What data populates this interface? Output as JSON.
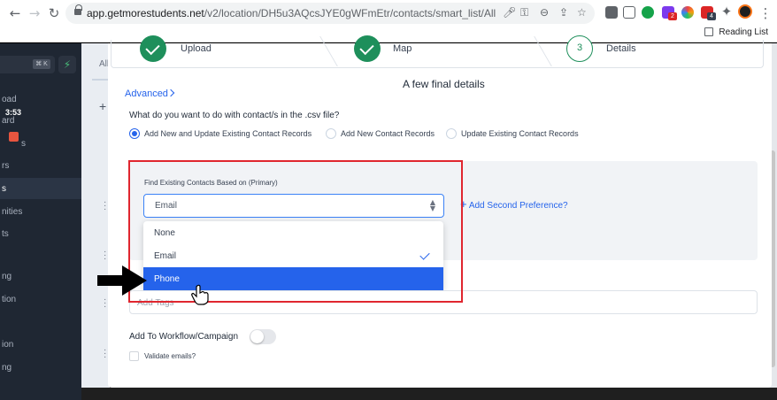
{
  "browser": {
    "url_host": "app.getmorestudents.net",
    "url_path": "/v2/location/DH5u3AQcsJYE0gWFmEtr/contacts/smart_list/All",
    "reading_list_label": "Reading List",
    "extension_badges": [
      "2",
      "4"
    ]
  },
  "sidebar": {
    "search_kbd": "⌘ K",
    "time": "3:53",
    "items": [
      {
        "label": "oad"
      },
      {
        "label": "ard"
      },
      {
        "label": "s"
      },
      {
        "label": "rs"
      },
      {
        "label": "s"
      },
      {
        "label": "nities"
      },
      {
        "label": "ts"
      },
      {
        "label": "ng"
      },
      {
        "label": "tion"
      },
      {
        "label": "ion"
      },
      {
        "label": "ng"
      }
    ]
  },
  "background": {
    "tab_label": "All",
    "add_label": "+"
  },
  "stepper": {
    "steps": [
      {
        "number": "",
        "label": "Upload",
        "status": "done"
      },
      {
        "number": "",
        "label": "Map",
        "status": "done"
      },
      {
        "number": "3",
        "label": "Details",
        "status": "current"
      }
    ]
  },
  "modal": {
    "advanced_label": "Advanced",
    "heading": "A few final details",
    "question": "What do you want to do with contact/s in the .csv file?",
    "radio_options": [
      {
        "label": "Add New and Update Existing Contact Records",
        "checked": true
      },
      {
        "label": "Add New Contact Records",
        "checked": false
      },
      {
        "label": "Update Existing Contact Records",
        "checked": false
      }
    ],
    "find_label": "Find Existing Contacts Based on (Primary)",
    "select_value": "Email",
    "add_second_label": "Add Second Preference?",
    "dropdown_options": [
      {
        "label": "None",
        "checked": false,
        "highlighted": false
      },
      {
        "label": "Email",
        "checked": true,
        "highlighted": false
      },
      {
        "label": "Phone",
        "checked": false,
        "highlighted": true
      }
    ],
    "tags_placeholder": "Add Tags",
    "workflow_label": "Add To Workflow/Campaign",
    "workflow_enabled": false,
    "validate_label": "Validate emails?",
    "validate_checked": false
  },
  "colors": {
    "accent_blue": "#2563eb",
    "step_green": "#1e8f5b",
    "highlight_red": "#e0262f",
    "sidebar_dark": "#1f2733"
  }
}
